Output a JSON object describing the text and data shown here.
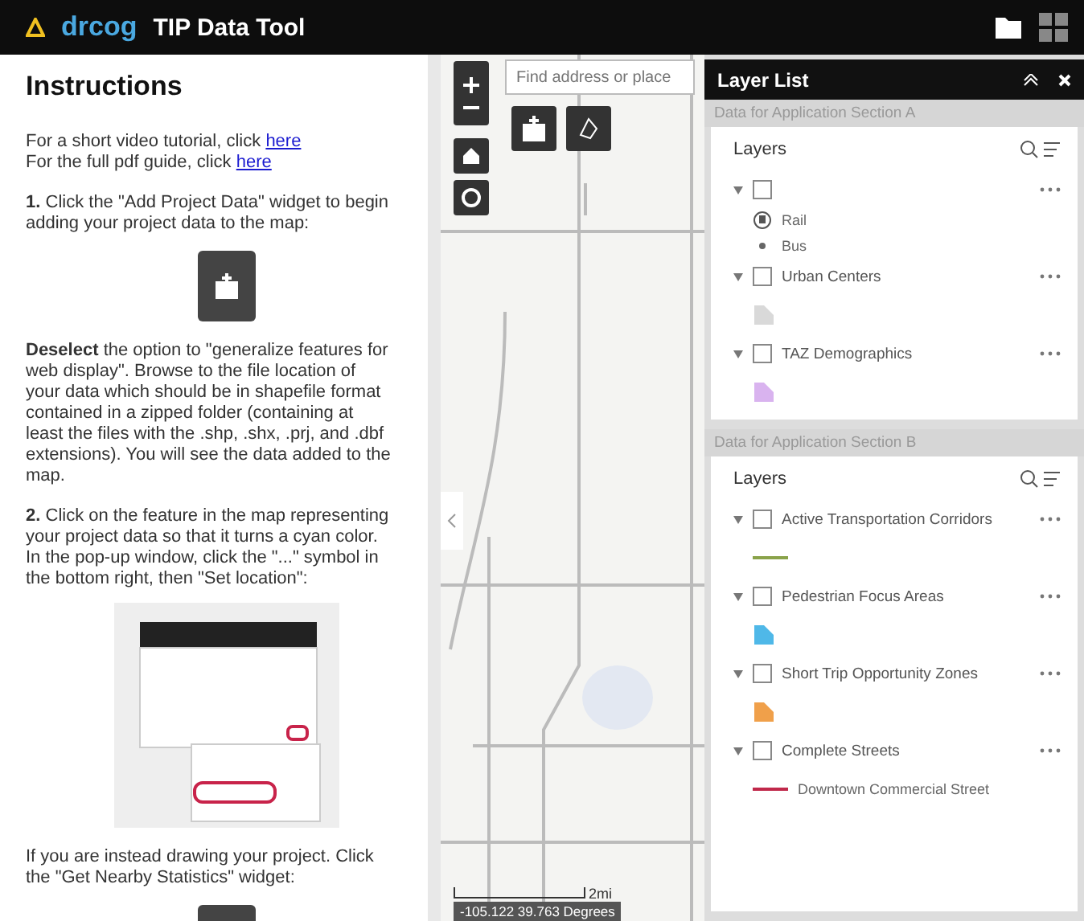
{
  "header": {
    "logo": "drcog",
    "title": "TIP Data Tool"
  },
  "instructions": {
    "title": "Instructions",
    "links": [
      {
        "text": "For a short video tutorial, click",
        "link": "here"
      },
      {
        "text": "For the full pdf guide, click",
        "link": "here"
      }
    ],
    "blocks": [
      {
        "kind": "text",
        "text": "**1.** Click the \"Add Project Data\" widget to begin adding your project data to the map:"
      },
      {
        "kind": "add-data-widget"
      },
      {
        "kind": "text",
        "text": "**Deselect** the option to \"generalize features for web display\". Browse to the file location of your data which should be in shapefile format contained in a zipped folder (containing at least the files with the .shp, .shx, .prj, and .dbf extensions). You will see the data added to the map."
      },
      {
        "kind": "text",
        "text": "**2.** Click on the feature in the map representing your project data so that it turns a cyan color. In the pop-up window, click the \"...\" symbol in the bottom right, then \"Set location\":"
      },
      {
        "kind": "screenshot"
      },
      {
        "kind": "text",
        "text": "If you are instead drawing your project. Click the \"Get Nearby Statistics\" widget:"
      },
      {
        "kind": "stats-widget"
      }
    ]
  },
  "map": {
    "search": {
      "placeholder": "Find address or place"
    },
    "scale": "2mi",
    "coordinates": "-105.122 39.763 Degrees"
  },
  "layer_list": {
    "title": "Layer List",
    "sections": [
      {
        "title": "Data for Application Section A",
        "heading": "Layers",
        "layers": [
          {
            "checked": false,
            "legend": [
              {
                "kind": "rail",
                "label": "Rail"
              },
              {
                "kind": "dot",
                "label": "Bus"
              }
            ]
          },
          {
            "name": "Urban Centers",
            "checked": false,
            "legend": [
              {
                "kind": "fill",
                "color": "#d9d9d9"
              }
            ]
          },
          {
            "name": "TAZ Demographics",
            "checked": false,
            "legend": [
              {
                "kind": "fill",
                "color": "#d9b3ef"
              }
            ]
          }
        ]
      },
      {
        "title": "Data for Application Section B",
        "heading": "Layers",
        "layers": [
          {
            "name": "Active Transportation Corridors",
            "checked": false,
            "legend": [
              {
                "kind": "line",
                "color": "#8aa34a"
              }
            ]
          },
          {
            "name": "Pedestrian Focus Areas",
            "checked": false,
            "legend": [
              {
                "kind": "fill",
                "color": "#4fb8e8"
              }
            ]
          },
          {
            "name": "Short Trip Opportunity Zones",
            "checked": false,
            "legend": [
              {
                "kind": "fill",
                "color": "#f0a04a"
              }
            ]
          },
          {
            "name": "Complete Streets",
            "checked": false,
            "legend": [
              {
                "kind": "line",
                "color": "#c0284a",
                "label": "Downtown Commercial Street"
              }
            ]
          }
        ]
      }
    ]
  }
}
